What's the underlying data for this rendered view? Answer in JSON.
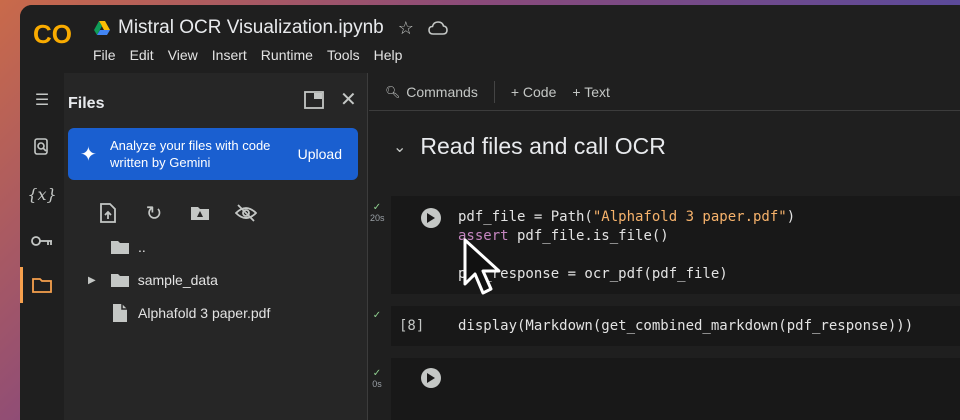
{
  "header": {
    "title": "Mistral OCR Visualization.ipynb",
    "menu": [
      "File",
      "Edit",
      "View",
      "Insert",
      "Runtime",
      "Tools",
      "Help"
    ]
  },
  "files_panel": {
    "title": "Files",
    "gemini_banner": {
      "text": "Analyze your files with code written by Gemini",
      "action": "Upload"
    },
    "items": [
      {
        "name": "..",
        "type": "folder-up"
      },
      {
        "name": "sample_data",
        "type": "folder"
      },
      {
        "name": "Alphafold 3 paper.pdf",
        "type": "file"
      }
    ]
  },
  "toolbar": {
    "commands": "Commands",
    "code": "+ Code",
    "text": "+ Text"
  },
  "section": {
    "title": "Read files and call OCR"
  },
  "cells": [
    {
      "exec_time": "20s",
      "lines": [
        "pdf_file = Path(\"Alphafold 3 paper.pdf\")",
        "assert pdf_file.is_file()",
        "",
        "pdf_response = ocr_pdf(pdf_file)"
      ]
    },
    {
      "exec_count": "[8]",
      "lines": [
        "display(Markdown(get_combined_markdown(pdf_response)))"
      ]
    },
    {
      "exec_time": "0s",
      "lines": []
    }
  ],
  "colors": {
    "accent": "#f6a04d",
    "banner": "#1a5fd0",
    "string": "#f6b26b",
    "keyword": "#c586c0"
  }
}
